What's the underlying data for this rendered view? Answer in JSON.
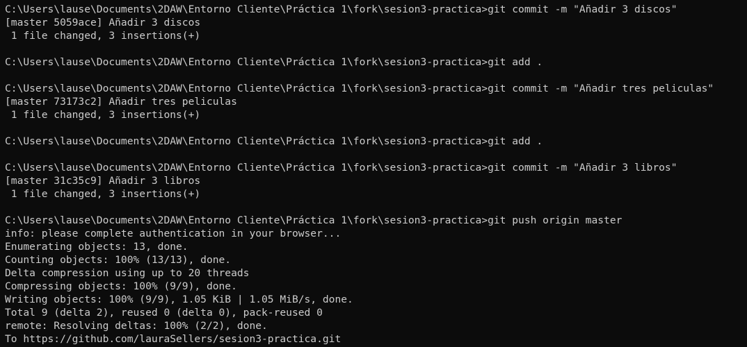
{
  "terminal": {
    "lines": [
      "C:\\Users\\lause\\Documents\\2DAW\\Entorno Cliente\\Práctica 1\\fork\\sesion3-practica>git commit -m \"Añadir 3 discos\"",
      "[master 5059ace] Añadir 3 discos",
      " 1 file changed, 3 insertions(+)",
      "",
      "C:\\Users\\lause\\Documents\\2DAW\\Entorno Cliente\\Práctica 1\\fork\\sesion3-practica>git add .",
      "",
      "C:\\Users\\lause\\Documents\\2DAW\\Entorno Cliente\\Práctica 1\\fork\\sesion3-practica>git commit -m \"Añadir tres peliculas\"",
      "[master 73173c2] Añadir tres peliculas",
      " 1 file changed, 3 insertions(+)",
      "",
      "C:\\Users\\lause\\Documents\\2DAW\\Entorno Cliente\\Práctica 1\\fork\\sesion3-practica>git add .",
      "",
      "C:\\Users\\lause\\Documents\\2DAW\\Entorno Cliente\\Práctica 1\\fork\\sesion3-practica>git commit -m \"Añadir 3 libros\"",
      "[master 31c35c9] Añadir 3 libros",
      " 1 file changed, 3 insertions(+)",
      "",
      "C:\\Users\\lause\\Documents\\2DAW\\Entorno Cliente\\Práctica 1\\fork\\sesion3-practica>git push origin master",
      "info: please complete authentication in your browser...",
      "Enumerating objects: 13, done.",
      "Counting objects: 100% (13/13), done.",
      "Delta compression using up to 20 threads",
      "Compressing objects: 100% (9/9), done.",
      "Writing objects: 100% (9/9), 1.05 KiB | 1.05 MiB/s, done.",
      "Total 9 (delta 2), reused 0 (delta 0), pack-reused 0",
      "remote: Resolving deltas: 100% (2/2), done.",
      "To https://github.com/lauraSellers/sesion3-practica.git"
    ]
  },
  "colors": {
    "background": "#0c0c0c",
    "foreground": "#cccccc"
  }
}
